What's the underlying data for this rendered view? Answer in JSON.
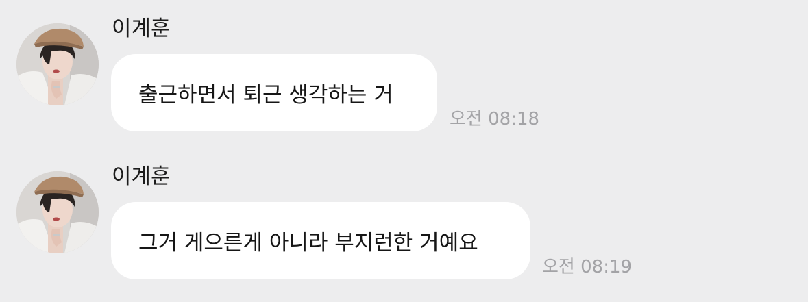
{
  "messages": [
    {
      "sender": "이계훈",
      "text": "출근하면서 퇴근 생각하는 거",
      "time": "오전 08:18"
    },
    {
      "sender": "이계훈",
      "text": "그거 게으른게 아니라 부지런한 거예요",
      "time": "오전 08:19"
    }
  ],
  "colors": {
    "background": "#ededee",
    "bubble": "#ffffff",
    "timestamp": "#a3a3a6",
    "text": "#161616"
  }
}
